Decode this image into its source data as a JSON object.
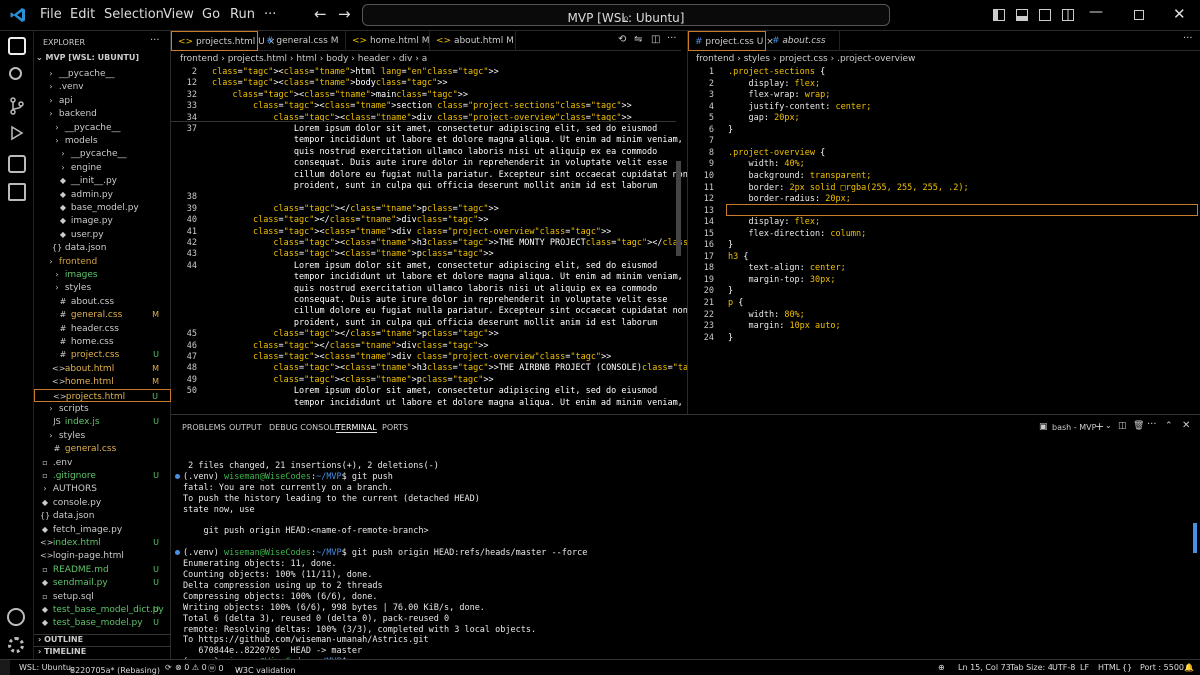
{
  "titlebar": {
    "menus": [
      "File",
      "Edit",
      "Selection",
      "View",
      "Go",
      "Run"
    ],
    "search": "MVP [WSL: Ubuntu]"
  },
  "sidebar": {
    "header": "EXPLORER",
    "root": "MVP [WSL: UBUNTU]",
    "items": [
      {
        "label": "__pycache__",
        "badge": ""
      },
      {
        "label": ".venv",
        "badge": ""
      },
      {
        "label": "api",
        "badge": ""
      },
      {
        "label": "backend",
        "badge": ""
      },
      {
        "label": "__pycache__",
        "badge": ""
      },
      {
        "label": "models",
        "badge": ""
      },
      {
        "label": "__pycache__",
        "badge": ""
      },
      {
        "label": "engine",
        "badge": ""
      },
      {
        "label": "__init__.py",
        "badge": ""
      },
      {
        "label": "admin.py",
        "badge": ""
      },
      {
        "label": "base_model.py",
        "badge": ""
      },
      {
        "label": "image.py",
        "badge": ""
      },
      {
        "label": "user.py",
        "badge": ""
      },
      {
        "label": "data.json",
        "badge": ""
      },
      {
        "label": "frontend",
        "badge": ""
      },
      {
        "label": "images",
        "badge": ""
      },
      {
        "label": "styles",
        "badge": ""
      },
      {
        "label": "about.css",
        "badge": ""
      },
      {
        "label": "general.css",
        "badge": "M"
      },
      {
        "label": "header.css",
        "badge": ""
      },
      {
        "label": "home.css",
        "badge": ""
      },
      {
        "label": "project.css",
        "badge": "U"
      },
      {
        "label": "about.html",
        "badge": "M"
      },
      {
        "label": "home.html",
        "badge": "M"
      },
      {
        "label": "projects.html",
        "badge": "U"
      },
      {
        "label": "scripts",
        "badge": ""
      },
      {
        "label": "index.js",
        "badge": "U"
      },
      {
        "label": "styles",
        "badge": ""
      },
      {
        "label": "general.css",
        "badge": ""
      },
      {
        "label": ".env",
        "badge": ""
      },
      {
        "label": ".gitignore",
        "badge": "U"
      },
      {
        "label": "AUTHORS",
        "badge": ""
      },
      {
        "label": "console.py",
        "badge": ""
      },
      {
        "label": "data.json",
        "badge": ""
      },
      {
        "label": "fetch_image.py",
        "badge": ""
      },
      {
        "label": "index.html",
        "badge": "U"
      },
      {
        "label": "login-page.html",
        "badge": ""
      },
      {
        "label": "README.md",
        "badge": "U"
      },
      {
        "label": "sendmail.py",
        "badge": "U"
      },
      {
        "label": "setup.sql",
        "badge": ""
      },
      {
        "label": "test_base_model_dict.py",
        "badge": "U"
      },
      {
        "label": "test_base_model.py",
        "badge": "U"
      }
    ],
    "outline": "OUTLINE",
    "timeline": "TIMELINE"
  },
  "editor_left": {
    "tabs": [
      {
        "label": "projects.html",
        "badge": "U"
      },
      {
        "label": "general.css",
        "badge": "M"
      },
      {
        "label": "home.html",
        "badge": "M"
      },
      {
        "label": "about.html",
        "badge": "M"
      }
    ],
    "breadcrumb": [
      "frontend",
      "projects.html",
      "html",
      "body",
      "header",
      "div",
      "a"
    ],
    "line_numbers": [
      "2",
      "12",
      "32",
      "33",
      "34",
      "37",
      "",
      "",
      "",
      "",
      "",
      "38",
      "39",
      "40",
      "41",
      "42",
      "43",
      "44",
      "",
      "",
      "",
      "",
      "",
      "45",
      "46",
      "47",
      "48",
      "49",
      "50",
      ""
    ],
    "lines": [
      "<html lang=\"en\">",
      "<body>",
      "    <main>",
      "        <section class=\"project-sections\">",
      "            <div class=\"project-overview\">",
      "                Lorem ipsum dolor sit amet, consectetur adipiscing elit, sed do eiusmod",
      "                tempor incididunt ut labore et dolore magna aliqua. Ut enim ad minim veniam,",
      "                quis nostrud exercitation ullamco laboris nisi ut aliquip ex ea commodo",
      "                consequat. Duis aute irure dolor in reprehenderit in voluptate velit esse",
      "                cillum dolore eu fugiat nulla pariatur. Excepteur sint occaecat cupidatat non",
      "                proident, sunt in culpa qui officia deserunt mollit anim id est laborum",
      "",
      "            </p>",
      "        </div>",
      "        <div class=\"project-overview\">",
      "            <h3>THE MONTY PROJECT</h3>",
      "            <p>",
      "                Lorem ipsum dolor sit amet, consectetur adipiscing elit, sed do eiusmod",
      "                tempor incididunt ut labore et dolore magna aliqua. Ut enim ad minim veniam,",
      "                quis nostrud exercitation ullamco laboris nisi ut aliquip ex ea commodo",
      "                consequat. Duis aute irure dolor in reprehenderit in voluptate velit esse",
      "                cillum dolore eu fugiat nulla pariatur. Excepteur sint occaecat cupidatat non",
      "                proident, sunt in culpa qui officia deserunt mollit anim id est laborum",
      "            </p>",
      "        </div>",
      "        <div class=\"project-overview\">",
      "            <h3>THE AIRBNB PROJECT (CONSOLE)</h3>",
      "            <p>",
      "                Lorem ipsum dolor sit amet, consectetur adipiscing elit, sed do eiusmod",
      "                tempor incididunt ut labore et dolore magna aliqua. Ut enim ad minim veniam,"
    ]
  },
  "editor_right": {
    "tabs": [
      {
        "label": "project.css",
        "badge": "U"
      },
      {
        "label": "about.css",
        "badge": ""
      }
    ],
    "breadcrumb": [
      "frontend",
      "styles",
      "project.css",
      ".project-overview"
    ],
    "line_numbers": [
      "1",
      "2",
      "3",
      "4",
      "5",
      "6",
      "7",
      "8",
      "9",
      "10",
      "11",
      "12",
      "13",
      "14",
      "15",
      "16",
      "17",
      "18",
      "19",
      "20",
      "21",
      "22",
      "23",
      "24"
    ],
    "lines": [
      ".project-sections {",
      "    display: flex;",
      "    flex-wrap: wrap;",
      "    justify-content: center;",
      "    gap: 20px;",
      "}",
      "",
      ".project-overview {",
      "    width: 40%;",
      "    background: transparent;",
      "    border: 2px solid □rgba(255, 255, 255, .2);",
      "    border-radius: 20px;",
      "",
      "    display: flex;",
      "    flex-direction: column;",
      "}",
      "h3 {",
      "    text-align: center;",
      "    margin-top: 30px;",
      "}",
      "p {",
      "    width: 80%;",
      "    margin: 10px auto;",
      "}"
    ]
  },
  "panel": {
    "tabs": [
      "PROBLEMS",
      "OUTPUT",
      "DEBUG CONSOLE",
      "TERMINAL",
      "PORTS"
    ],
    "shell": "bash - MVP",
    "terminal": [
      " 2 files changed, 21 insertions(+), 2 deletions(-)",
      "(.venv) wiseman@WiseCodes:~/MVP$ git push",
      "fatal: You are not currently on a branch.",
      "To push the history leading to the current (detached HEAD)",
      "state now, use",
      "",
      "    git push origin HEAD:<name-of-remote-branch>",
      "",
      "(.venv) wiseman@WiseCodes:~/MVP$ git push origin HEAD:refs/heads/master --force",
      "Enumerating objects: 11, done.",
      "Counting objects: 100% (11/11), done.",
      "Delta compression using up to 2 threads",
      "Compressing objects: 100% (6/6), done.",
      "Writing objects: 100% (6/6), 998 bytes | 76.00 KiB/s, done.",
      "Total 6 (delta 3), reused 0 (delta 0), pack-reused 0",
      "remote: Resolving deltas: 100% (3/3), completed with 3 local objects.",
      "To https://github.com/wiseman-umanah/Astrics.git",
      "   670844e..8220705  HEAD -> master",
      "(.venv) wiseman@WiseCodes:~/MVP$ "
    ]
  },
  "status": {
    "remote": "WSL: Ubuntu",
    "branch": "8220705a* (Rebasing)",
    "problems": "⊗ 0 ⚠ 0",
    "ports": "ⓦ 0",
    "w3c": "W3C validation",
    "position": "Ln 15, Col 73",
    "tabsize": "Tab Size: 4",
    "encoding": "UTF-8",
    "eol": "LF",
    "lang": "HTML",
    "port": "Port : 5500"
  },
  "colors": {
    "accent": "#c97b2a",
    "prompt": "#3cb44b",
    "path": "#4a90e2",
    "keyword": "#f0c000"
  }
}
